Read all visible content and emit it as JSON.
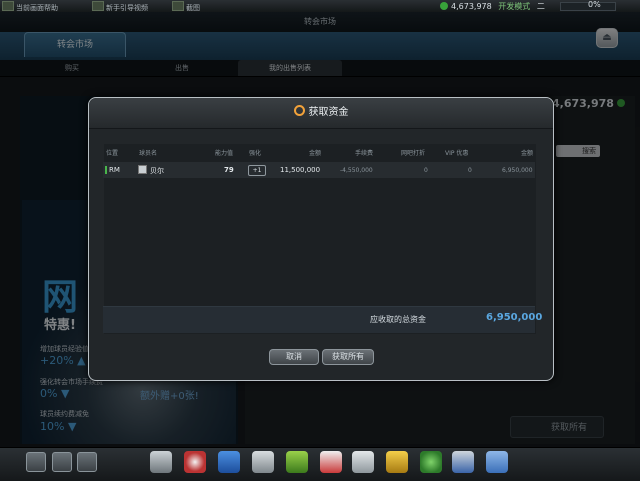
{
  "topbar": {
    "items": [
      "当前画面帮助",
      "新手引导视频",
      "截图"
    ],
    "coins": "4,673,978",
    "extra": "开发模式",
    "level": "二",
    "percent": "0%",
    "progress_fraction": 0.0
  },
  "title": "转会市场",
  "market_tab": "转会市场",
  "subtabs": [
    "购买",
    "出售",
    "我的出售列表"
  ],
  "background": {
    "coins": "4,673,978",
    "search_btn": "搜索",
    "collect_all_btn": "获取所有",
    "promo": {
      "big": "网",
      "special": "特惠!",
      "line1": "增加球员经验值",
      "val1": "+20% ▲",
      "line2": "强化转会市场手续费",
      "val2": "0% ▼",
      "line3": "球员续约费减免",
      "val3": "10% ▼",
      "side1": "额外赠+0张!"
    }
  },
  "modal": {
    "title": "获取资金",
    "headers": [
      "位置",
      "球员名",
      "能力值",
      "强化",
      "金额",
      "手续费",
      "网吧打折",
      "VIP 优惠",
      "金额"
    ],
    "rows": [
      {
        "position": "RM",
        "player_name": "贝尔",
        "rating": "79",
        "enhance": "+1",
        "amount": "11,500,000",
        "fee": "-4,550,000",
        "netcafe_discount": "0",
        "vip_discount": "0",
        "final_amount": "6,950,000"
      }
    ],
    "total_label": "应收取的总资金",
    "total_value": "6,950,000",
    "cancel_btn": "取消",
    "collect_all_btn": "获取所有"
  },
  "colors": {
    "accent": "#5aa7e0",
    "header_blue": "#2d5a7a",
    "position_green": "#49b64b"
  },
  "bottom_icons": [
    "save-icon",
    "chat-icon",
    "mail-icon",
    "whistle-icon",
    "ball-icon",
    "boots-icon",
    "trophy-icon",
    "cone-icon",
    "jersey-icon",
    "card-icon",
    "medal-icon",
    "club-icon",
    "stadium-icon",
    "cart-icon"
  ]
}
